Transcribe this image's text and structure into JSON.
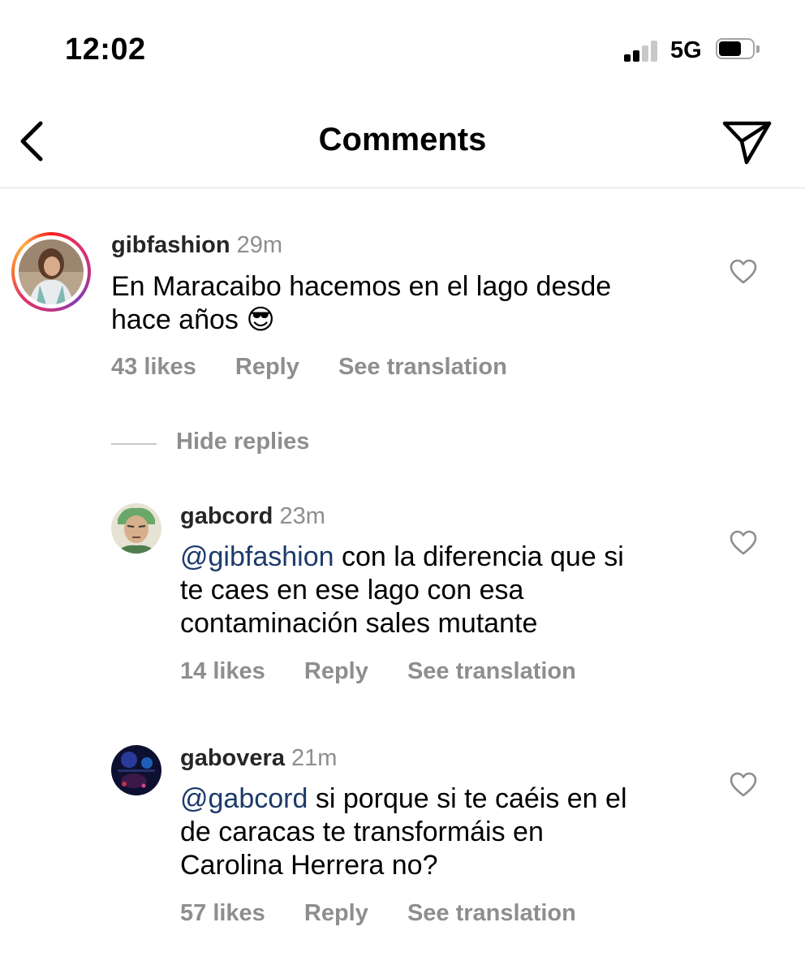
{
  "status_bar": {
    "time": "12:02",
    "network": "5G",
    "signal_bars_active": 2,
    "signal_bars_total": 4,
    "battery_level": 0.6,
    "icons": [
      "signal-icon",
      "battery-icon"
    ]
  },
  "header": {
    "title": "Comments",
    "back_icon": "chevron-left-icon",
    "send_icon": "paper-plane-icon"
  },
  "comments": [
    {
      "username": "gibfashion",
      "time": "29m",
      "mention": "",
      "lines": [
        "En Maracaibo hacemos en el lago desde",
        "hace años 😎"
      ],
      "likes": "43 likes",
      "reply": "Reply",
      "translate": "See translation",
      "story_ring": true
    }
  ],
  "hide_replies": "Hide replies",
  "replies": [
    {
      "username": "gabcord",
      "time": "23m",
      "mention": "@gibfashion",
      "first_line_rest": " con la diferencia que si",
      "lines": [
        "te caes en ese lago con esa",
        "contaminación sales mutante"
      ],
      "likes": "14 likes",
      "reply": "Reply",
      "translate": "See translation"
    },
    {
      "username": "gabovera",
      "time": "21m",
      "mention": "@gabcord",
      "first_line_rest": " si porque si te caéis en el",
      "lines": [
        "de caracas te transformáis en",
        "Carolina Herrera no?"
      ],
      "likes": "57 likes",
      "reply": "Reply",
      "translate": "See translation"
    }
  ],
  "colors": {
    "mention": "#1d3a6b",
    "secondary_text": "#8e8e8e",
    "divider": "#dbdbdb"
  }
}
